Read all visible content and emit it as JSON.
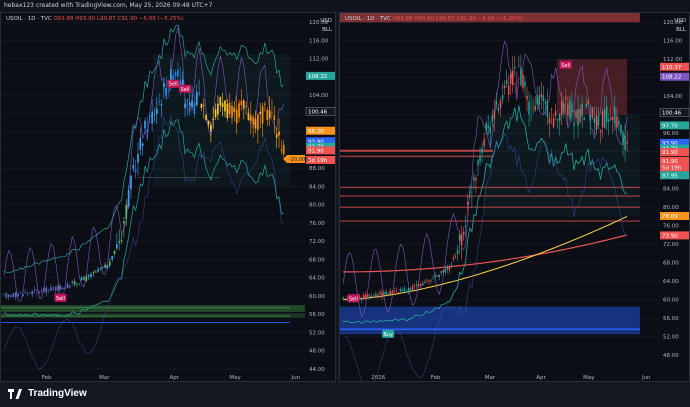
{
  "header": {
    "text": "hebax123 created with TradingView.com, May 25, 2026 09:48 UTC+7"
  },
  "footer": {
    "logo_text": "TradingView"
  },
  "colors": {
    "background": "#131722",
    "up": "#26a69a",
    "down": "#ef5350",
    "orange": "#f7931a",
    "blue": "#2962ff",
    "purple": "#7e57c2",
    "yellow": "#ffd54f"
  },
  "panes": [
    {
      "id": "left",
      "symbol_label": "USOIL · 1D · TVC",
      "ohlc": {
        "o": "O93.88",
        "h": "H93.90",
        "l": "L90.87",
        "c": "C91.90",
        "chg": "−5.09 (−5.25%)"
      },
      "currency": "USD",
      "unit": "BLL",
      "y_ticks": [
        "120.00",
        "116.00",
        "112.00",
        "108.00",
        "104.00",
        "100.00",
        "96.00",
        "92.00",
        "88.00",
        "84.00",
        "80.00",
        "76.00",
        "72.00",
        "68.00",
        "64.00",
        "60.00",
        "56.00",
        "52.00",
        "48.00",
        "44.00"
      ],
      "y_min": 44,
      "y_max": 122,
      "x_ticks": [
        "Feb",
        "Mar",
        "Apr",
        "May",
        "Jun"
      ],
      "price_tags": [
        {
          "value": 108.22,
          "text": "108.22",
          "color": "#26a69a"
        },
        {
          "value": 100.46,
          "text": "100.46",
          "color": "#131722"
        },
        {
          "value": 96.2,
          "text": "96.20",
          "color": "#f7931a"
        },
        {
          "value": 93.9,
          "text": "93.90",
          "color": "#2962ff"
        },
        {
          "value": 92.7,
          "text": "92.70",
          "color": "#26a69a"
        },
        {
          "value": 91.9,
          "text": "91.90",
          "color": "#ef5350"
        },
        {
          "value": 89.8,
          "text": "5d 19h",
          "color": "#ef5350"
        }
      ],
      "side_tag": {
        "value": 90.0,
        "text": "-20.00%"
      },
      "signals": [
        {
          "text": "Sell",
          "day": 24,
          "value": 59.6
        },
        {
          "text": "Sell",
          "day": 72,
          "value": 106.5
        },
        {
          "text": "Sell",
          "day": 77,
          "value": 105.4
        }
      ]
    },
    {
      "id": "right",
      "symbol_label": "USOIL · 1D · TVC",
      "ohlc": {
        "o": "O93.88",
        "h": "H93.90",
        "l": "L90.87",
        "c": "C91.90",
        "chg": "−5.09 (−5.25%)"
      },
      "currency": "USD",
      "unit": "BLL",
      "y_ticks": [
        "120.00",
        "116.00",
        "112.00",
        "108.00",
        "104.00",
        "100.00",
        "96.00",
        "92.00",
        "88.00",
        "84.00",
        "80.00",
        "76.00",
        "72.00",
        "68.00",
        "64.00",
        "60.00",
        "56.00",
        "52.00",
        "48.00"
      ],
      "y_min": 45,
      "y_max": 122,
      "x_ticks": [
        "2026",
        "Feb",
        "Mar",
        "Apr",
        "May",
        "Jun"
      ],
      "price_tags": [
        {
          "value": 110.37,
          "text": "110.37",
          "color": "#ef5350"
        },
        {
          "value": 108.22,
          "text": "108.22",
          "color": "#7e57c2"
        },
        {
          "value": 100.46,
          "text": "100.46",
          "color": "#131722"
        },
        {
          "value": 97.7,
          "text": "97.70",
          "color": "#26a69a"
        },
        {
          "value": 93.9,
          "text": "93.90",
          "color": "#2962ff"
        },
        {
          "value": 92.7,
          "text": "92.70",
          "color": "#26a69a"
        },
        {
          "value": 91.9,
          "text": "91.90",
          "color": "#ef5350"
        },
        {
          "value": 90.0,
          "text": "91.90",
          "color": "#ef5350"
        },
        {
          "value": 88.6,
          "text": "5d 19h",
          "color": "#ef5350"
        },
        {
          "value": 86.9,
          "text": "87.95",
          "color": "#26a69a"
        },
        {
          "value": 78.1,
          "text": "78.09",
          "color": "#f7931a"
        },
        {
          "value": 73.9,
          "text": "73.90",
          "color": "#ef5350"
        }
      ],
      "signals": [
        {
          "text": "Sell",
          "day": 109,
          "value": 110.8
        },
        {
          "text": "Sell",
          "day": 5,
          "value": 60.3
        },
        {
          "text": "Buy",
          "day": 22,
          "value": 52.6
        }
      ]
    }
  ]
}
